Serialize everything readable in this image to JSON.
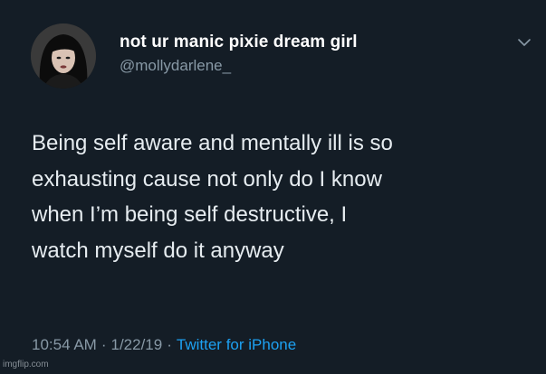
{
  "tweet": {
    "display_name": "not ur manic pixie dream girl",
    "handle": "@mollydarlene_",
    "text_lines": [
      "Being self aware and mentally ill is so",
      "exhausting cause not only do I know",
      "when I’m being self destructive, I",
      "watch myself do it anyway"
    ],
    "time": "10:54 AM",
    "separator": "·",
    "date": "1/22/19",
    "source": "Twitter for iPhone",
    "menu_icon": "chevron-down-icon"
  },
  "watermark": "imgflip.com",
  "colors": {
    "background": "#141d26",
    "name": "#ffffff",
    "handle": "#8899a6",
    "text": "#e6ecf0",
    "link": "#1da1f2"
  }
}
